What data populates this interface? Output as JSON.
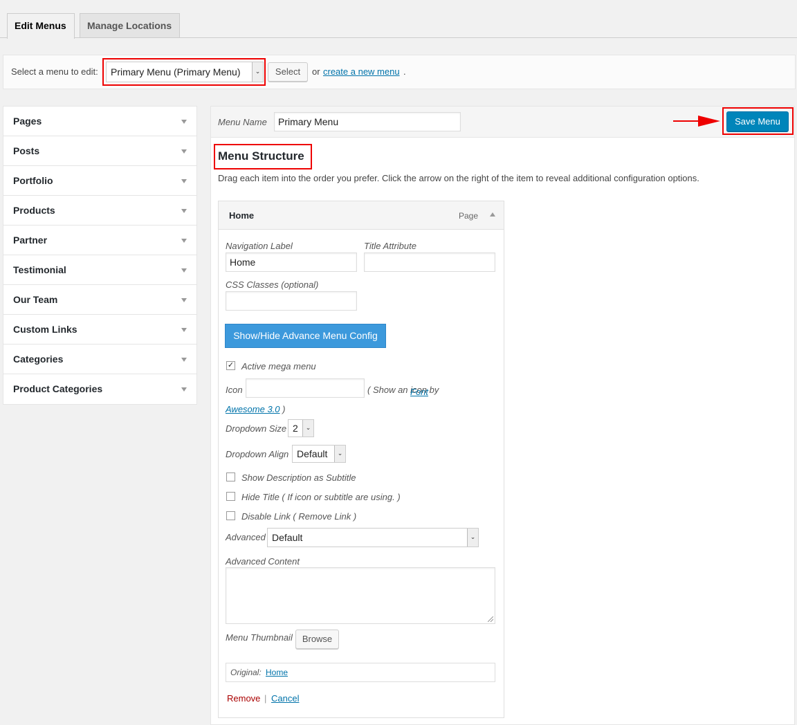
{
  "tabs": {
    "edit_menus": "Edit Menus",
    "manage_locations": "Manage Locations"
  },
  "select_bar": {
    "label": "Select a menu to edit:",
    "selected_menu": "Primary Menu (Primary Menu)",
    "select_button": "Select",
    "or_text": "or",
    "create_link": "create a new menu",
    "period": "."
  },
  "sidebar": {
    "items": [
      {
        "label": "Pages"
      },
      {
        "label": "Posts"
      },
      {
        "label": "Portfolio"
      },
      {
        "label": "Products"
      },
      {
        "label": "Partner"
      },
      {
        "label": "Testimonial"
      },
      {
        "label": "Our Team"
      },
      {
        "label": "Custom Links"
      },
      {
        "label": "Categories"
      },
      {
        "label": "Product Categories"
      }
    ]
  },
  "panel": {
    "menu_name_label": "Menu Name",
    "menu_name_value": "Primary Menu",
    "save_button": "Save Menu",
    "structure_title": "Menu Structure",
    "structure_desc": "Drag each item into the order you prefer. Click the arrow on the right of the item to reveal additional configuration options."
  },
  "menu_item": {
    "title": "Home",
    "type": "Page",
    "nav_label_label": "Navigation Label",
    "nav_label_value": "Home",
    "title_attr_label": "Title Attribute",
    "title_attr_value": "",
    "css_classes_label": "CSS Classes (optional)",
    "css_classes_value": "",
    "advance_button": "Show/Hide Advance Menu Config",
    "active_mega_label": "Active mega menu",
    "active_mega_checked": true,
    "icon_label": "Icon",
    "icon_value": "",
    "icon_hint_pre": "( Show an icon by",
    "icon_hint_link": "Font Awesome 3.0",
    "icon_hint_post": ")",
    "dropdown_size_label": "Dropdown Size",
    "dropdown_size_value": "2",
    "dropdown_align_label": "Dropdown Align",
    "dropdown_align_value": "Default",
    "show_desc_label": "Show Description as Subtitle",
    "hide_title_label": "Hide Title ( If icon or subtitle are using. )",
    "disable_link_label": "Disable Link ( Remove Link )",
    "advanced_label": "Advanced",
    "advanced_value": "Default",
    "advanced_content_label": "Advanced Content",
    "thumbnail_label": "Menu Thumbnail",
    "browse_button": "Browse",
    "original_label": "Original:",
    "original_link": "Home",
    "remove_link": "Remove",
    "separator": "|",
    "cancel_link": "Cancel"
  },
  "colors": {
    "primary_button": "#0085ba",
    "highlight": "#ee0000",
    "advance_button": "#3c99dc",
    "link": "#0073aa",
    "remove": "#aa0000"
  }
}
